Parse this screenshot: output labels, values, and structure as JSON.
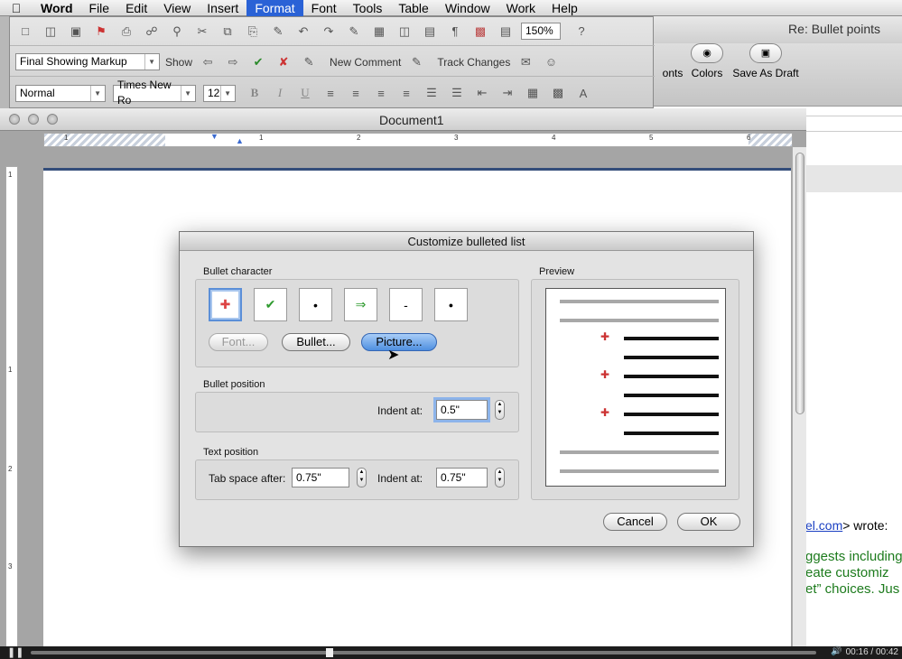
{
  "menubar": {
    "app": "Word",
    "items": [
      "File",
      "Edit",
      "View",
      "Insert",
      "Format",
      "Font",
      "Tools",
      "Table",
      "Window",
      "Work",
      "Help"
    ],
    "active": "Format"
  },
  "mail": {
    "subject": "Re: Bullet points",
    "toolbar": {
      "fonts": "onts",
      "colors": "Colors",
      "save_draft": "Save As Draft"
    },
    "wrote_link": "el.com",
    "wrote_suffix": "> wrote:",
    "lines": [
      "ggests including",
      "eate customiz",
      "et” choices. Jus"
    ]
  },
  "toolbar": {
    "zoom": "150%",
    "markup_mode": "Final Showing Markup",
    "show_label": "Show",
    "new_comment": "New Comment",
    "track_changes": "Track Changes",
    "style": "Normal",
    "font_name": "Times New Ro",
    "font_size": "12",
    "bold": "B",
    "italic": "I",
    "underline": "U"
  },
  "document": {
    "title": "Document1",
    "ruler_numbers": [
      "1",
      "1",
      "2",
      "3",
      "4",
      "5",
      "6"
    ],
    "vruler_numbers": [
      "1",
      "1",
      "2",
      "3"
    ]
  },
  "dialog": {
    "title": "Customize bulleted list",
    "bullet_character": {
      "label": "Bullet character",
      "glyphs": [
        "✚",
        "✔",
        "•",
        "⇒",
        "-",
        "●"
      ],
      "selected_index": 0
    },
    "buttons": {
      "font": "Font...",
      "bullet": "Bullet...",
      "picture": "Picture..."
    },
    "bullet_position": {
      "label": "Bullet position",
      "indent_label": "Indent at:",
      "indent_value": "0.5\""
    },
    "text_position": {
      "label": "Text position",
      "tab_label": "Tab space after:",
      "tab_value": "0.75\"",
      "indent_label": "Indent at:",
      "indent_value": "0.75\""
    },
    "preview_label": "Preview",
    "cancel": "Cancel",
    "ok": "OK"
  },
  "movie": {
    "time": "00:16 / 00:42",
    "progress_fraction": 0.38
  }
}
